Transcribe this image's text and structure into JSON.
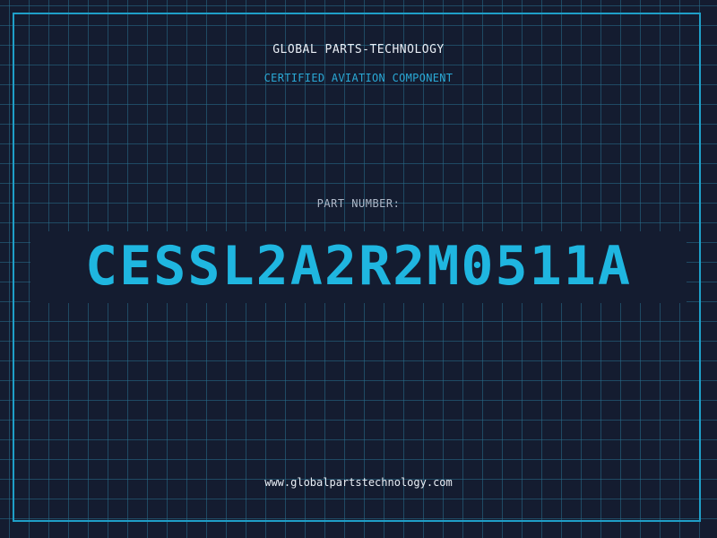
{
  "header": {
    "company": "GLOBAL PARTS-TECHNOLOGY",
    "subtitle": "CERTIFIED AVIATION COMPONENT"
  },
  "part": {
    "label": "PART NUMBER:",
    "number": "CESSL2A2R2M0511A"
  },
  "footer": {
    "website": "www.globalpartstechnology.com"
  },
  "colors": {
    "background": "#141c30",
    "grid": "#286e8c",
    "accent": "#1fb6e0",
    "text": "#e9eef5"
  }
}
